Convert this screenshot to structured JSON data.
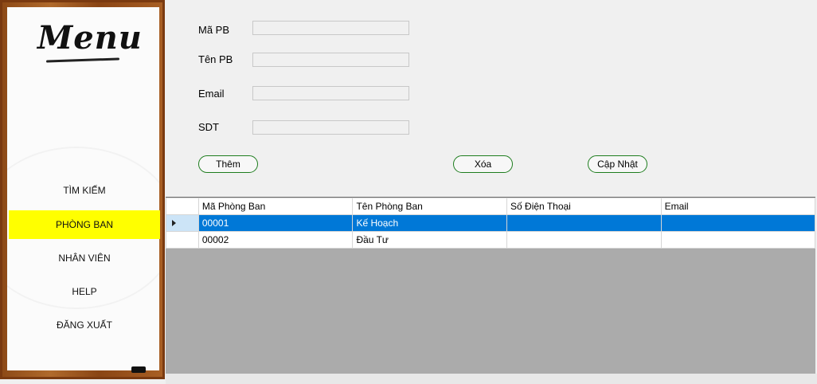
{
  "sidebar": {
    "logo_text": "Menu",
    "items": [
      {
        "label": "TÌM KIẾM"
      },
      {
        "label": "PHÒNG BAN"
      },
      {
        "label": "NHÂN VIÊN"
      },
      {
        "label": "HELP"
      },
      {
        "label": "ĐĂNG XUẤT"
      }
    ],
    "active_item": "PHÒNG BAN",
    "active_color": "#ffff00"
  },
  "form": {
    "fields": [
      {
        "label": "Mã PB",
        "value": ""
      },
      {
        "label": "Tên PB",
        "value": ""
      },
      {
        "label": "Email",
        "value": ""
      },
      {
        "label": "SDT",
        "value": ""
      }
    ],
    "buttons": {
      "add": "Thêm",
      "delete": "Xóa",
      "update": "Cập Nhật"
    }
  },
  "grid": {
    "columns": [
      "Mã Phòng Ban",
      "Tên Phòng Ban",
      "Số Điện Thoại",
      "Email"
    ],
    "rows": [
      {
        "ma": "00001",
        "ten": "Kế Hoạch",
        "sdt": "",
        "email": "",
        "selected": true
      },
      {
        "ma": "00002",
        "ten": "Đầu Tư",
        "sdt": "",
        "email": "",
        "selected": false
      }
    ],
    "selection_color": "#0078d7"
  }
}
